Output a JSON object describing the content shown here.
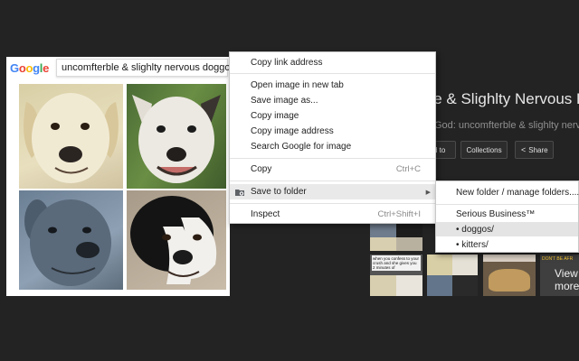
{
  "background_page": {
    "title": "ble & Slighlty Nervous D",
    "subtitle": "God: uncomfterble & slighlty nervous d",
    "buttons": {
      "partial": "d to",
      "collections": "Collections",
      "share": "Share"
    },
    "thumb_texts": {
      "caption": "when you confess to your crush and she gives you 2 minutes of",
      "dont_be": "DON'T BE AFR",
      "view_more": "View more"
    }
  },
  "image_card": {
    "logo": [
      "G",
      "o",
      "o",
      "g",
      "l",
      "e"
    ],
    "logo_colors": [
      "#4285f4",
      "#ea4335",
      "#fbbc05",
      "#4285f4",
      "#34a853",
      "#ea4335"
    ],
    "search_query": "uncomfterble & slighlty nervous doggos"
  },
  "context_menu": {
    "items": {
      "copy_link": "Copy link address",
      "open_new_tab": "Open image in new tab",
      "save_as": "Save image as...",
      "copy_image": "Copy image",
      "copy_image_address": "Copy image address",
      "search_google": "Search Google for image",
      "copy": "Copy",
      "save_to_folder": "Save to folder",
      "inspect": "Inspect"
    },
    "shortcuts": {
      "copy": "Ctrl+C",
      "inspect": "Ctrl+Shift+I"
    },
    "icons": {
      "folder": "folder-gear-icon",
      "submenu": "triangle-right-icon"
    }
  },
  "submenu": {
    "new_folder": "New folder / manage folders....",
    "group_title": "Serious Business™",
    "folders": [
      "• doggos/",
      "• kitters/"
    ]
  },
  "colors": {
    "page_bg": "#232323",
    "menu_bg": "#ffffff",
    "menu_hover": "#e9e9e9"
  }
}
